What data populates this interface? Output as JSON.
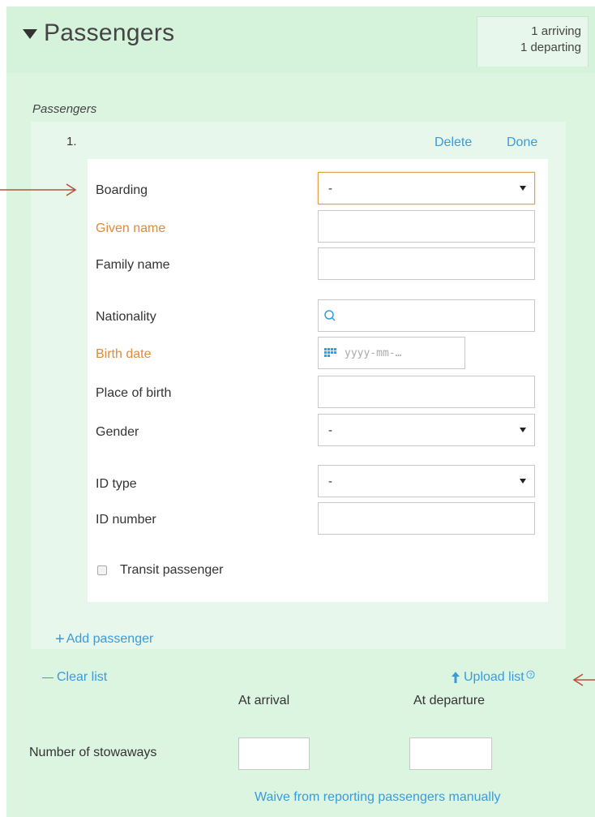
{
  "section": {
    "title": "Passengers",
    "arriving": "1 arriving",
    "departing": "1 departing",
    "subheading": "Passengers"
  },
  "passenger": {
    "number": "1.",
    "delete_label": "Delete",
    "done_label": "Done",
    "fields": {
      "boarding": {
        "label": "Boarding",
        "value": "-"
      },
      "given_name": {
        "label": "Given name",
        "value": ""
      },
      "family_name": {
        "label": "Family name",
        "value": ""
      },
      "nationality": {
        "label": "Nationality",
        "value": ""
      },
      "birth_date": {
        "label": "Birth date",
        "placeholder": "yyyy-mm-…"
      },
      "place_of_birth": {
        "label": "Place of birth",
        "value": ""
      },
      "gender": {
        "label": "Gender",
        "value": "-"
      },
      "id_type": {
        "label": "ID type",
        "value": "-"
      },
      "id_number": {
        "label": "ID number",
        "value": ""
      }
    },
    "transit_label": "Transit passenger",
    "transit_checked": false
  },
  "actions": {
    "add_passenger": "Add passenger",
    "clear_list": "Clear list",
    "upload_list": "Upload list"
  },
  "stowaways": {
    "label": "Number of stowaways",
    "at_arrival": "At arrival",
    "at_departure": "At departure",
    "arrival_value": "",
    "departure_value": ""
  },
  "waive_link": "Waive from reporting passengers manually",
  "icons": {
    "caret": "caret-down-icon",
    "search": "search-icon",
    "calendar": "calendar-icon",
    "upload": "upload-arrow-icon",
    "help": "help-circle-icon",
    "annotation": "annotation-arrow-icon"
  },
  "colors": {
    "link": "#3a9bd9",
    "required_label": "#e08a3c",
    "panel_bg": "#dcf5e1",
    "annotation_arrow": "#b5533f"
  }
}
